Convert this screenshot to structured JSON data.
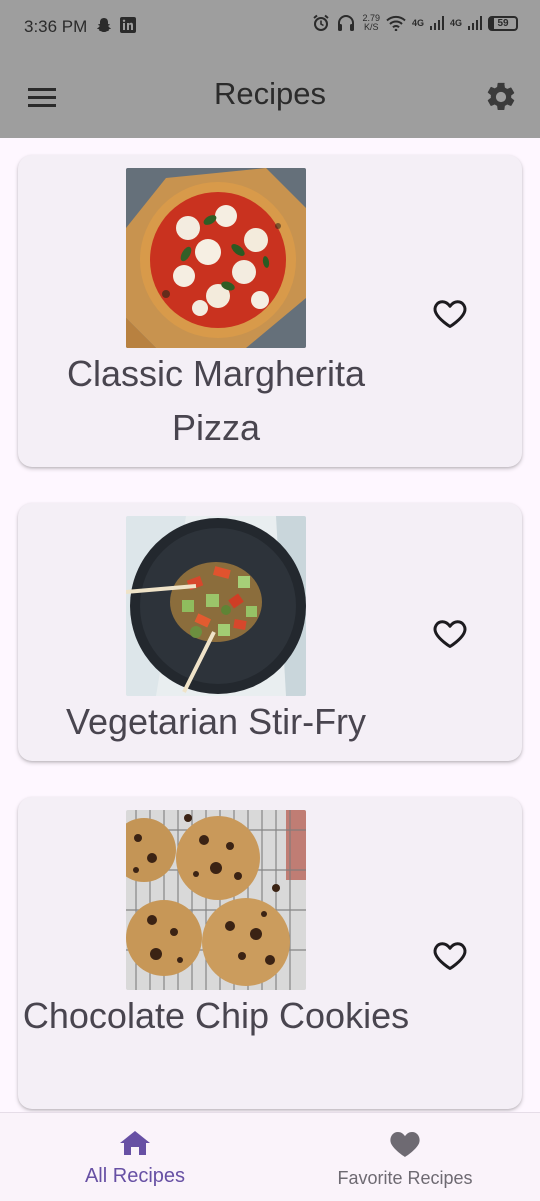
{
  "status": {
    "time": "3:36 PM",
    "speed_value": "2.79",
    "speed_unit": "K/S",
    "network1": "4G",
    "network2": "4G",
    "battery": "59"
  },
  "app_bar": {
    "title": "Recipes"
  },
  "recipes": [
    {
      "name": "Classic Margherita Pizza",
      "favorite": false
    },
    {
      "name": "Vegetarian Stir-Fry",
      "favorite": false
    },
    {
      "name": "Chocolate Chip Cookies",
      "favorite": false
    }
  ],
  "bottom_nav": {
    "items": [
      {
        "label": "All Recipes",
        "active": true
      },
      {
        "label": "Favorite Recipes",
        "active": false
      }
    ]
  },
  "colors": {
    "app_bar": "#9E9E9E",
    "background": "#FEF7FF",
    "card": "#F4EFF6",
    "accent": "#6750A4",
    "inactive": "#6E6A72"
  }
}
